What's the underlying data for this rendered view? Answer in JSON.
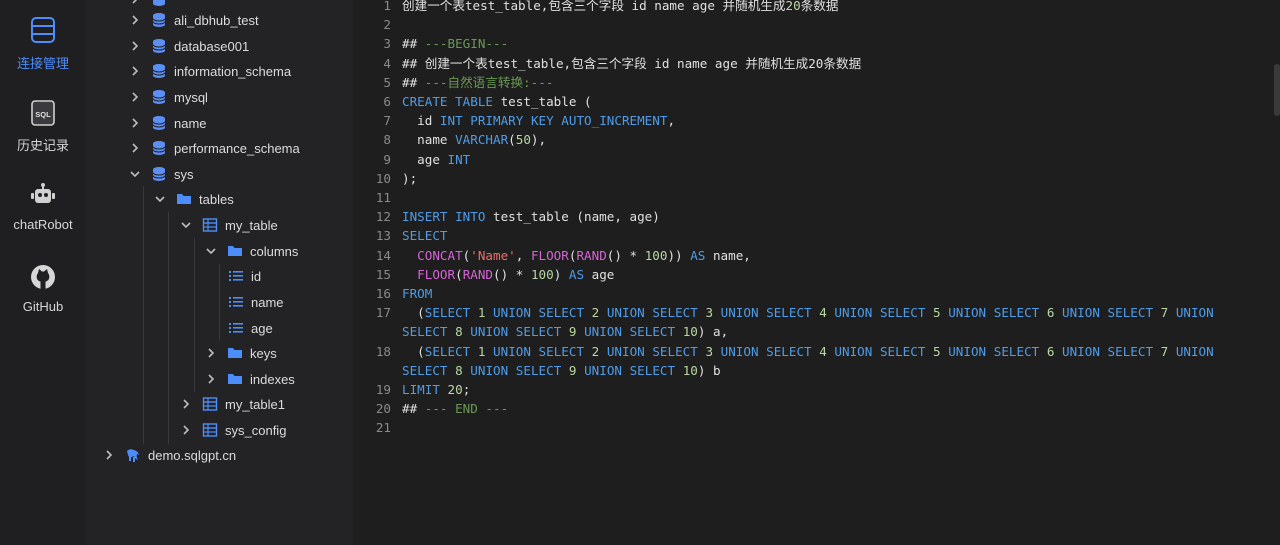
{
  "nav": {
    "items": [
      {
        "label": "连接管理",
        "icon": "database-stack-icon",
        "active": true
      },
      {
        "label": "历史记录",
        "icon": "sql-file-icon",
        "active": false
      },
      {
        "label": "chatRobot",
        "icon": "robot-icon",
        "active": false
      },
      {
        "label": "GitHub",
        "icon": "github-icon",
        "active": false
      }
    ]
  },
  "tree": {
    "databases": [
      "ali_dbhub_test",
      "database001",
      "information_schema",
      "mysql",
      "name",
      "performance_schema",
      "sys"
    ],
    "tables_folder": "tables",
    "table": "my_table",
    "columns_folder": "columns",
    "columns": [
      "id",
      "name",
      "age"
    ],
    "keys_folder": "keys",
    "indexes_folder": "indexes",
    "other_tables": [
      "my_table1",
      "sys_config"
    ],
    "connection": "demo.sqlgpt.cn"
  },
  "editor": {
    "lines": [
      "创建一个表test_table,包含三个字段 id name age 并随机生成20条数据",
      "",
      "## ---BEGIN---",
      "## 创建一个表test_table,包含三个字段 id name age 并随机生成20条数据",
      "## ---自然语言转换:---",
      "CREATE TABLE test_table (",
      "  id INT PRIMARY KEY AUTO_INCREMENT,",
      "  name VARCHAR(50),",
      "  age INT",
      ");",
      "",
      "INSERT INTO test_table (name, age)",
      "SELECT",
      "  CONCAT('Name', FLOOR(RAND() * 100)) AS name,",
      "  FLOOR(RAND() * 100) AS age",
      "FROM",
      "  (SELECT 1 UNION SELECT 2 UNION SELECT 3 UNION SELECT 4 UNION SELECT 5 UNION SELECT 6 UNION SELECT 7 UNION SELECT 8 UNION SELECT 9 UNION SELECT 10) a,",
      "  (SELECT 1 UNION SELECT 2 UNION SELECT 3 UNION SELECT 4 UNION SELECT 5 UNION SELECT 6 UNION SELECT 7 UNION SELECT 8 UNION SELECT 9 UNION SELECT 10) b",
      "LIMIT 20;",
      "## --- END ---",
      ""
    ]
  },
  "colors": {
    "accent": "#4d8dfa",
    "keyword": "#4f9ce8",
    "function": "#d664d6",
    "string": "#ec6e6e",
    "number": "#b8d7a3",
    "comment": "#6a9955"
  }
}
